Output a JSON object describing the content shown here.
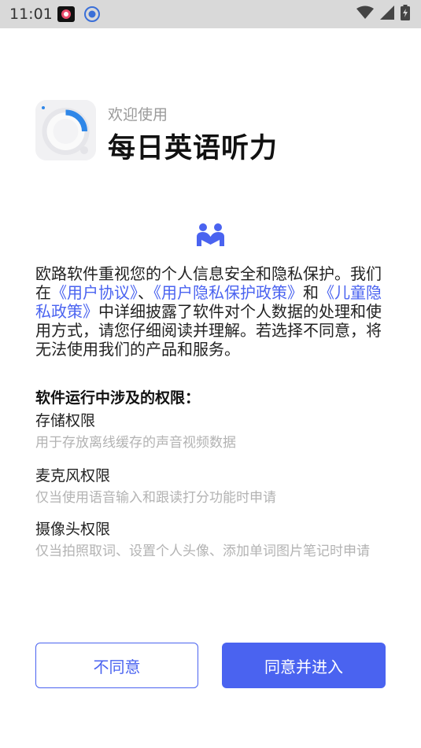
{
  "status_bar": {
    "time": "11:01"
  },
  "header": {
    "welcome": "欢迎使用",
    "app_name": "每日英语听力"
  },
  "intro": {
    "text_1": "欧路软件重视您的个人信息安全和隐私保护。我们在",
    "link_user_agreement": "《用户协议》",
    "sep_1": "、",
    "link_privacy_policy": "《用户隐私保护政策》",
    "sep_2": "和",
    "link_child_privacy": "《儿童隐私政策》",
    "text_2": "中详细披露了软件对个人数据的处理和使用方式，请您仔细阅读并理解。若选择不同意，将无法使用我们的产品和服务。"
  },
  "permissions": {
    "title": "软件运行中涉及的权限：",
    "items": [
      {
        "name": "存储权限",
        "desc": "用于存放离线缓存的声音视频数据"
      },
      {
        "name": "麦克风权限",
        "desc": "仅当使用语音输入和跟读打分功能时申请"
      },
      {
        "name": "摄像头权限",
        "desc": "仅当拍照取词、设置个人头像、添加单词图片笔记时申请"
      }
    ]
  },
  "buttons": {
    "decline": "不同意",
    "accept": "同意并进入"
  },
  "colors": {
    "accent": "#4a63f0",
    "status_bar": "#d9d9d9",
    "muted_text": "#b3b3b3"
  },
  "icons": [
    "app-logo-icon",
    "people-icon",
    "wifi-icon",
    "signal-icon",
    "battery-icon"
  ]
}
